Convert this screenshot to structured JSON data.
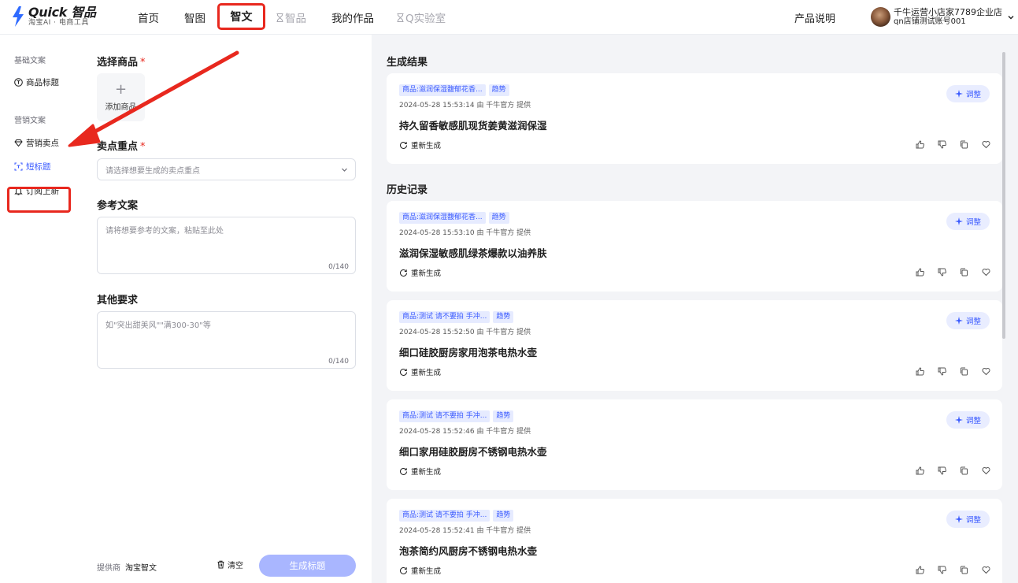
{
  "header": {
    "logo_title": "Quick 智品",
    "logo_subtitle": "淘宝AI · 电商工具",
    "nav": [
      {
        "label": "首页"
      },
      {
        "label": "智图"
      },
      {
        "label": "智文"
      },
      {
        "label": "智品"
      },
      {
        "label": "我的作品"
      },
      {
        "label": "Q实验室"
      }
    ],
    "product_help": "产品说明",
    "user_name": "千牛运营小店家7789企业店",
    "user_account": "qn店铺测试账号001"
  },
  "sidebar": {
    "group_basic": "基础文案",
    "item_product_title": "商品标题",
    "group_marketing": "营销文案",
    "item_selling_points": "营销卖点",
    "item_short_title": "短标题",
    "item_subscribe": "订阅上新"
  },
  "form": {
    "select_product_label": "选择商品",
    "required_mark": "*",
    "add_product": "添加商品",
    "key_points_label": "卖点重点",
    "key_points_placeholder": "请选择想要生成的卖点重点",
    "reference_label": "参考文案",
    "reference_placeholder": "请将想要参考的文案，粘贴至此处",
    "reference_count": "0/140",
    "other_label": "其他要求",
    "other_placeholder": "如\"突出甜美风\"\"满300-30\"等",
    "other_count": "0/140",
    "provider_label": "提供商",
    "provider_value": "淘宝智文",
    "clear_label": "清空",
    "generate_label": "生成标题"
  },
  "results": {
    "result_heading": "生成结果",
    "history_heading": "历史记录",
    "regen_label": "重新生成",
    "adjust_label": "调整",
    "cards": [
      {
        "tag_product": "商品:滋润保湿馥郁花香...",
        "tag_trend": "趋势",
        "meta": "2024-05-28 15:53:14 由 千牛官方 提供",
        "title": "持久留香敏感肌现货姜黄滋润保湿"
      },
      {
        "tag_product": "商品:滋润保湿馥郁花香...",
        "tag_trend": "趋势",
        "meta": "2024-05-28 15:53:10 由 千牛官方 提供",
        "title": "滋润保湿敏感肌绿茶爆款以油养肤"
      },
      {
        "tag_product": "商品:测试 请不要拍 手冲...",
        "tag_trend": "趋势",
        "meta": "2024-05-28 15:52:50 由 千牛官方 提供",
        "title": "细口硅胶厨房家用泡茶电热水壶"
      },
      {
        "tag_product": "商品:测试 请不要拍 手冲...",
        "tag_trend": "趋势",
        "meta": "2024-05-28 15:52:46 由 千牛官方 提供",
        "title": "细口家用硅胶厨房不锈钢电热水壶"
      },
      {
        "tag_product": "商品:测试 请不要拍 手冲...",
        "tag_trend": "趋势",
        "meta": "2024-05-28 15:52:41 由 千牛官方 提供",
        "title": "泡茶简约风厨房不锈钢电热水壶"
      }
    ]
  },
  "colors": {
    "accent": "#3b5bff",
    "annotation_red": "#e8281e",
    "generate_button": "#a9b6ff"
  }
}
